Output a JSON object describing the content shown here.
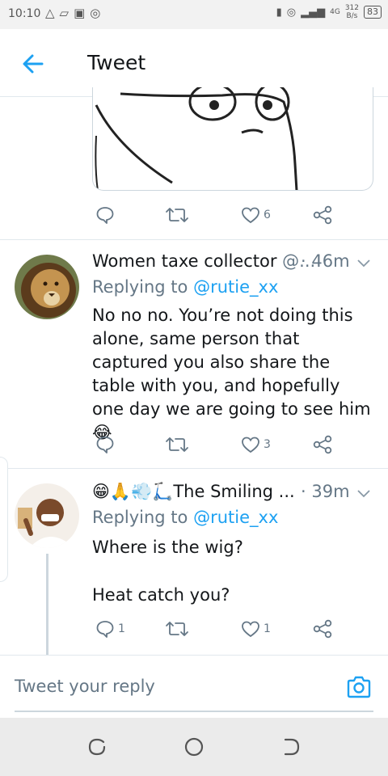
{
  "status_bar": {
    "time": "10:10",
    "net_speed_value": "312",
    "net_speed_unit": "B/s",
    "battery": "83",
    "network_type": "4G"
  },
  "header": {
    "title": "Tweet",
    "back_icon": "arrow-left-icon"
  },
  "colors": {
    "accent": "#1da1f2",
    "secondary_text": "#657786",
    "divider": "#e1e8ed",
    "primary_text": "#14171a"
  },
  "tweets": [
    {
      "like_count": "6"
    },
    {
      "name": "Women taxe collector",
      "handle": "@...",
      "time": "· 46m",
      "replying_prefix": "Replying to ",
      "replying_to": "@rutie_xx",
      "body": "No no no. You’re not doing this alone, same person that captured you also share the table with you, and hopefully one day we are going to see him 😂",
      "like_count": "3"
    },
    {
      "name": "😁🙏💨🛴The Smiling ...",
      "time": "· 39m",
      "replying_prefix": "Replying to ",
      "replying_to": "@rutie_xx",
      "body_line1": "Where is the wig?",
      "body_line2": "Heat catch you?",
      "reply_count": "1",
      "like_count": "1"
    }
  ],
  "reply_bar": {
    "placeholder": "Tweet your reply",
    "camera_icon": "camera-icon"
  }
}
